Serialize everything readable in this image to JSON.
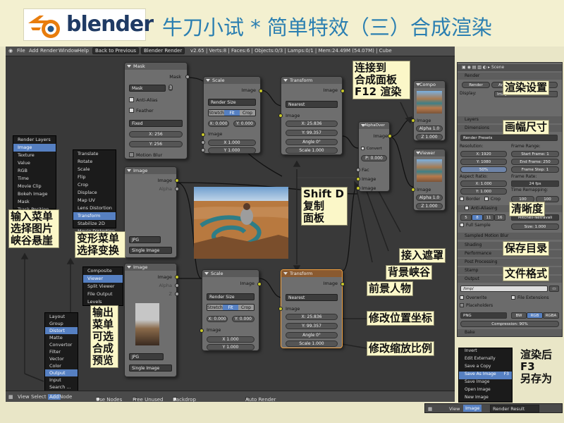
{
  "page": {
    "title": "牛刀小试 * 简单特效（三）合成渲染",
    "logo_text": "blender"
  },
  "topbar": {
    "menus": [
      "File",
      "Add",
      "Render",
      "Window",
      "Help"
    ],
    "back_button": "Back to Previous",
    "render_engine": "Blender Render",
    "stats": "v2.65 | Verts:8 | Faces:6 | Objects:0/3 | Lamps:0/1 | Mem:24.49M (54.07M) | Cube"
  },
  "bottombar": {
    "menus": [
      "View",
      "Select",
      "Add",
      "Node"
    ],
    "use_nodes": "Use Nodes",
    "free_unused": "Free Unused",
    "backdrop": "Backdrop",
    "auto_render": "Auto Render"
  },
  "nodes": {
    "mask": {
      "title": "Mask",
      "mask_name": "Mask",
      "users": "3",
      "anti_alias": "Anti-Alias",
      "feather": "Feather",
      "size_mode": "Fixed",
      "x": "X: 256",
      "y": "Y: 256",
      "motion_blur": "Motion Blur",
      "out_mask": "Mask"
    },
    "scale1": {
      "title": "Scale",
      "in_image": "Image",
      "mode": "Render Size",
      "tabs": [
        "Stretch",
        "Fit",
        "Crop"
      ],
      "active_tab": "Fit",
      "offx": "X: 0.000",
      "offy": "Y: 0.000",
      "out_image": "Image",
      "x": "X 1.000",
      "y": "Y 1.000"
    },
    "transform1": {
      "title": "Transform",
      "out_image": "Image",
      "filter": "Nearest",
      "in_image": "Image",
      "x": "X: 25.836",
      "y": "Y: 99.357",
      "angle": "Angle 0°",
      "scale": "Scale 1.000"
    },
    "alphaover": {
      "title": "AlphaOver",
      "out_image": "Image",
      "convert": "Convert",
      "premul": "P: 0.000",
      "fac": "Fac",
      "in1": "Image",
      "in2": "Image"
    },
    "composite": {
      "title": "Compo",
      "in_image": "Image",
      "alpha": "Alpha 1.0",
      "z": "Z 1.000"
    },
    "viewer": {
      "title": "Viewer",
      "in_image": "Image",
      "alpha": "Alpha 1.0",
      "z": "Z 1.000"
    },
    "image1": {
      "title": "Image",
      "out_image": "Image",
      "out_alpha": "Alpha",
      "file": "JPG",
      "mode": "Single Image"
    },
    "image2": {
      "title": "Image",
      "out_image": "Image",
      "out_alpha": "Alpha",
      "out_z": "Z",
      "file": "JPG",
      "mode": "Single Image"
    },
    "scale2": {
      "title": "Scale",
      "in_image": "Image",
      "mode": "Render Size",
      "tabs": [
        "Stretch",
        "Fit",
        "Crop"
      ],
      "active_tab": "Fit",
      "offx": "X: 0.000",
      "offy": "Y: 0.000",
      "out_image": "Image",
      "x": "X 1.000",
      "y": "Y 1.000"
    },
    "transform2": {
      "title": "Transform",
      "out_image": "Image",
      "filter": "Nearest",
      "in_image": "Image",
      "x": "X: 25.836",
      "y": "Y: 99.357",
      "angle": "Angle 0°",
      "scale": "Scale 1.000"
    }
  },
  "menus": {
    "input": {
      "items": [
        "Render Layers",
        "Image",
        "Texture",
        "Value",
        "RGB",
        "Time",
        "Movie Clip",
        "Bokeh Image",
        "Mask",
        "Track Position"
      ],
      "selected": "Image"
    },
    "distort": {
      "items": [
        "Translate",
        "Rotate",
        "Scale",
        "Flip",
        "Crop",
        "Displace",
        "Map UV",
        "Lens Distortion",
        "Transform",
        "Stabilize 2D",
        "Movie Distortion"
      ],
      "selected": "Transform"
    },
    "output": {
      "items": [
        "Composite",
        "Viewer",
        "Split Viewer",
        "File Output",
        "Levels"
      ],
      "selected": "Viewer"
    },
    "add": {
      "items": [
        "Layout",
        "Group",
        "Distort",
        "Matte",
        "Convertor",
        "Filter",
        "Vector",
        "Color",
        "Output",
        "Input",
        "Search ..."
      ],
      "selected": [
        "Distort",
        "Output"
      ]
    }
  },
  "properties": {
    "scene": "Scene",
    "render_header": "Render",
    "buttons": [
      "Render",
      "Animation",
      "Play"
    ],
    "display_label": "Display:",
    "display_value": "Image Editor",
    "layers": "Layers",
    "dimensions": "Dimensions",
    "render_presets": "Render Presets",
    "resolution": "Resolution:",
    "frame_range": "Frame Range:",
    "res_x": "X: 1920",
    "res_y": "Y: 1080",
    "res_pct": "50%",
    "start_frame": "Start Frame: 1",
    "end_frame": "End Frame: 250",
    "frame_step": "Frame Step: 1",
    "aspect": "Aspect Ratio:",
    "frame_rate": "Frame Rate:",
    "asp_x": "X: 1.000",
    "asp_y": "Y: 1.000",
    "fps": "24 fps",
    "time_remap": "Time Remapping:",
    "border": "Border",
    "crop": "Crop",
    "old": "100",
    "new": "100",
    "anti_aliasing": "Anti-Aliasing",
    "aa_samples": [
      "5",
      "8",
      "11",
      "16"
    ],
    "aa_active": "8",
    "aa_filter": "Mitchell-Netravali",
    "full_sample": "Full Sample",
    "size": "Size: 1.000",
    "sampled_motion_blur": "Sampled Motion Blur",
    "shading": "Shading",
    "performance": "Performance",
    "post_processing": "Post Processing",
    "stamp": "Stamp",
    "output": "Output",
    "path": "/tmp/",
    "overwrite": "Overwrite",
    "file_extensions": "File Extensions",
    "placeholders": "Placeholders",
    "format": "PNG",
    "color_modes": [
      "BW",
      "RGB",
      "RGBA"
    ],
    "color_active": "RGB",
    "compression": "Compression: 90%",
    "bake": "Bake"
  },
  "image_menu": {
    "items": [
      "Invert",
      "Edit Externally",
      "Save a Copy",
      "Save As Image",
      "Save Image",
      "Open Image",
      "New Image"
    ],
    "shortcuts": [
      "",
      "",
      "",
      "F3",
      "",
      "",
      ""
    ],
    "selected": "Save As Image"
  },
  "image_bar": {
    "view": "View",
    "image": "Image",
    "result": "Render Result"
  },
  "annotations": {
    "connect_composite": "连接到\n合成面板\nF12 渲染",
    "render_settings": "渲染设置",
    "frame_size": "画幅尺寸",
    "clarity": "清晰度",
    "save_dir": "保存目录",
    "file_format": "文件格式",
    "input_menu": "输入菜单\n选择图片\n峡谷悬崖",
    "distort_menu": "变形菜单\n选择变换",
    "output_menu": "输出\n菜单\n可选\n合成\n预览",
    "shift_d": "Shift D\n复制\n面板",
    "mask_input": "接入遮罩",
    "bg_canyon": "背景峡谷",
    "fg_person": "前景人物",
    "modify_pos": "修改位置坐标",
    "modify_scale": "修改缩放比例",
    "save_after_render": "渲染后\nF3\n另存为"
  }
}
